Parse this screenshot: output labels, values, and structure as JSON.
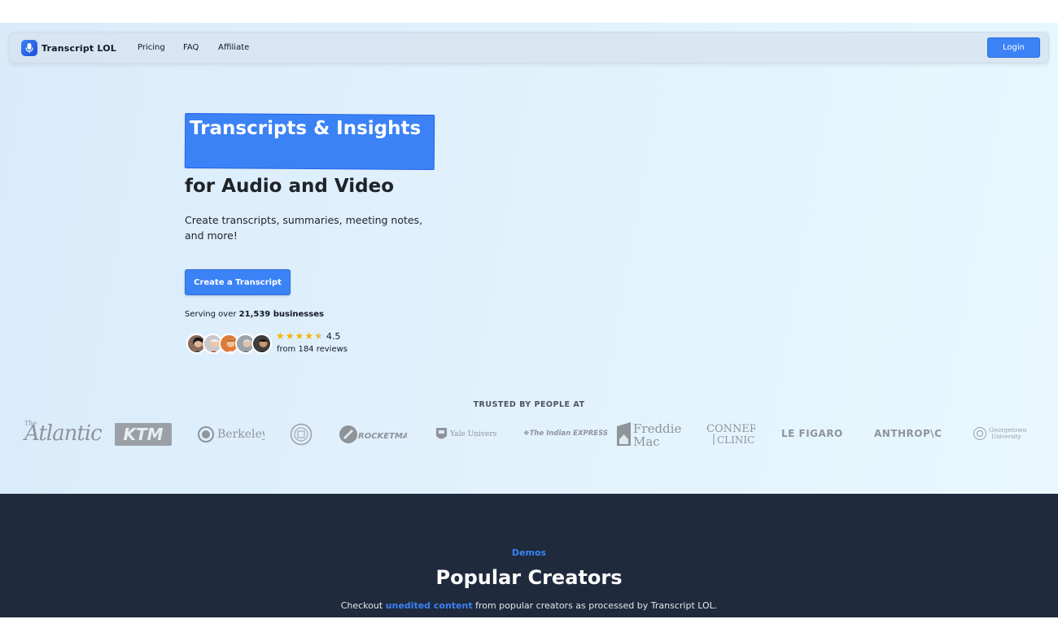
{
  "nav": {
    "logo_text": "Transcript LOL",
    "links": [
      "Pricing",
      "FAQ",
      "Affiliate"
    ],
    "login_label": "Login"
  },
  "hero": {
    "headline_highlight": "Transcripts & Insights",
    "headline_rest": "for Audio and Video",
    "description": "Create transcripts, summaries, meeting notes, and more!",
    "cta_label": "Create a Transcript",
    "serving_prefix": "Serving over ",
    "serving_count": "21,539 businesses",
    "rating": "4.5",
    "stars": 4.5,
    "reviews": "from 184 reviews"
  },
  "trusted": {
    "heading": "TRUSTED BY PEOPLE AT",
    "logos": [
      "The Atlantic",
      "KTM",
      "Berkeley",
      "Cornell seal",
      "RocketMail",
      "Yale University",
      "The Indian EXPRESS",
      "Freddie Mac",
      "Conner Clinic",
      "LE FIGARO",
      "ANTHROPIC",
      "Georgetown University"
    ]
  },
  "demos": {
    "eyebrow": "Demos",
    "title": "Popular Creators",
    "sub_prefix": "Checkout ",
    "sub_highlight": "unedited content",
    "sub_suffix": " from popular creators as processed by Transcript LOL."
  },
  "colors": {
    "accent": "#3b82f6",
    "dark_bg": "#1f2a3c",
    "star": "#f5b400"
  }
}
